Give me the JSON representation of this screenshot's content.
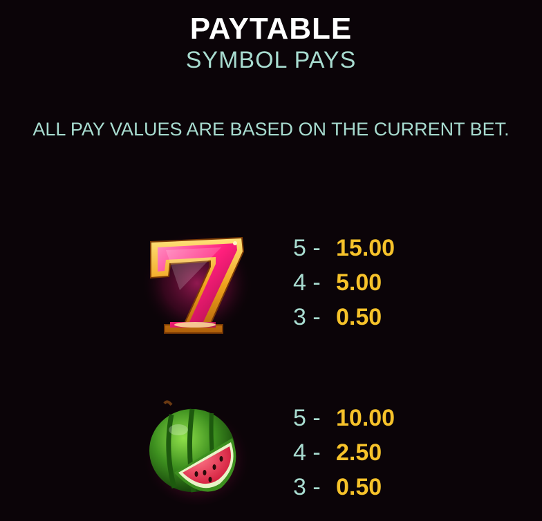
{
  "header": {
    "title": "PAYTABLE",
    "subtitle": "SYMBOL PAYS"
  },
  "notice": "ALL PAY VALUES ARE BASED ON THE CURRENT BET.",
  "symbols": [
    {
      "icon": "lucky-seven-icon",
      "pays": [
        {
          "count": "5 -",
          "value": "15.00"
        },
        {
          "count": "4 -",
          "value": "5.00"
        },
        {
          "count": "3 -",
          "value": "0.50"
        }
      ]
    },
    {
      "icon": "watermelon-icon",
      "pays": [
        {
          "count": "5 -",
          "value": "10.00"
        },
        {
          "count": "4 -",
          "value": "2.50"
        },
        {
          "count": "3 -",
          "value": "0.50"
        }
      ]
    }
  ],
  "colors": {
    "background": "#0b0408",
    "title": "#ffffff",
    "text": "#a8dcd0",
    "value": "#f6c22a"
  }
}
